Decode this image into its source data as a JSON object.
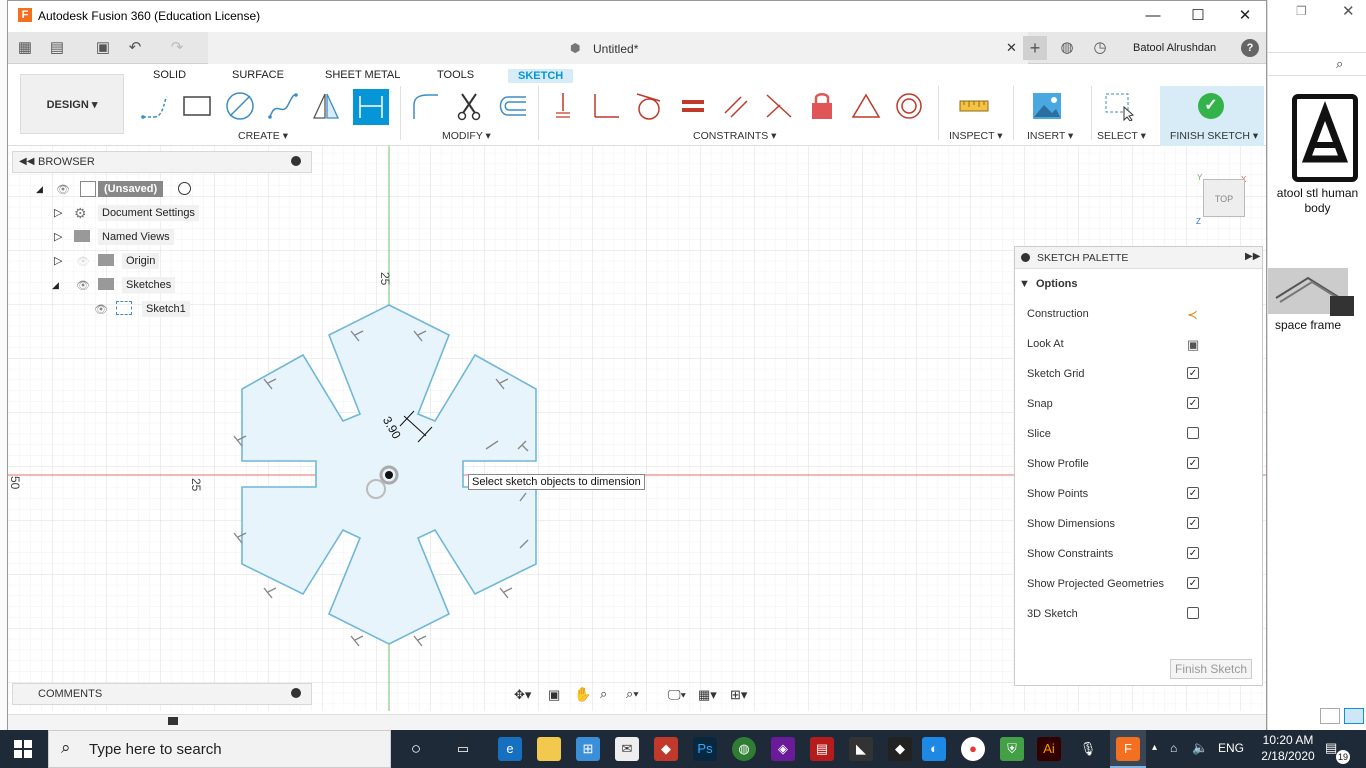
{
  "window": {
    "title": "Autodesk Fusion 360 (Education License)",
    "document_title": "Untitled*",
    "user_name": "Batool Alrushdan"
  },
  "ribbon": {
    "workspace": "DESIGN ▾",
    "tabs": [
      "SOLID",
      "SURFACE",
      "SHEET METAL",
      "TOOLS",
      "SKETCH"
    ],
    "active_tab": "SKETCH",
    "groups": {
      "create": "CREATE ▾",
      "modify": "MODIFY ▾",
      "constraints": "CONSTRAINTS ▾",
      "inspect": "INSPECT ▾",
      "insert": "INSERT ▾",
      "select": "SELECT ▾",
      "finish": "FINISH SKETCH ▾"
    }
  },
  "browser": {
    "title": "BROWSER",
    "items": [
      {
        "label": "(Unsaved)"
      },
      {
        "label": "Document Settings"
      },
      {
        "label": "Named Views"
      },
      {
        "label": "Origin"
      },
      {
        "label": "Sketches"
      },
      {
        "label": "Sketch1"
      }
    ]
  },
  "comments": {
    "title": "COMMENTS"
  },
  "canvas": {
    "tooltip": "Select sketch objects to dimension",
    "dimension": "3.90",
    "axis_label_top": "25",
    "axis_label_left_far": "50",
    "axis_label_left_near": "25",
    "viewcube_label": "TOP"
  },
  "palette": {
    "title": "SKETCH PALETTE",
    "section": "Options",
    "rows": [
      {
        "label": "Construction",
        "control": "icon"
      },
      {
        "label": "Look At",
        "control": "icon"
      },
      {
        "label": "Sketch Grid",
        "checked": true
      },
      {
        "label": "Snap",
        "checked": true
      },
      {
        "label": "Slice",
        "checked": false
      },
      {
        "label": "Show Profile",
        "checked": true
      },
      {
        "label": "Show Points",
        "checked": true
      },
      {
        "label": "Show Dimensions",
        "checked": true
      },
      {
        "label": "Show Constraints",
        "checked": true
      },
      {
        "label": "Show Projected Geometries",
        "checked": true
      },
      {
        "label": "3D Sketch",
        "checked": false
      }
    ],
    "finish_button": "Finish Sketch"
  },
  "desktop": {
    "icon1_label": "atool stl human body",
    "icon2_label": "space frame"
  },
  "taskbar": {
    "search_placeholder": "Type here to search",
    "language": "ENG",
    "time": "10:20 AM",
    "date": "2/18/2020",
    "notifications": "19"
  },
  "colors": {
    "accent": "#0696d7",
    "sketch_line": "#6fb7d8",
    "profile_fill": "#e8f4fb",
    "axis_red": "#e06060",
    "axis_green": "#5cb85c",
    "taskbar": "#1f2a38"
  }
}
